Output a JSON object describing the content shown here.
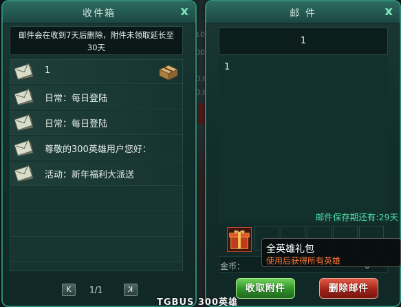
{
  "inbox": {
    "title": "收件箱",
    "close_label": "x",
    "notice": "邮件会在收到7天后删除，附件未领取延长至30天",
    "notice_line1": "邮件会在收到7天后删除，附件未领取延长至",
    "notice_line2": "30天",
    "mails": [
      {
        "subject": "1",
        "icon": "envelope-icon",
        "has_attachment": true
      },
      {
        "subject": "日常：每日登陆",
        "icon": "envelope-icon",
        "has_attachment": false
      },
      {
        "subject": "日常：每日登陆",
        "icon": "envelope-icon",
        "has_attachment": false
      },
      {
        "subject": "尊敬的300英雄用户您好：",
        "icon": "envelope-icon",
        "has_attachment": false
      },
      {
        "subject": "活动：新年福利大派送",
        "icon": "envelope-icon",
        "has_attachment": false
      }
    ],
    "pager": {
      "prev_label": "K",
      "page_text": "1/1",
      "next_label": "K"
    }
  },
  "mail": {
    "title": "邮 件",
    "close_label": "x",
    "subject": "1",
    "body": "1",
    "expiry_text": "邮件保存期还有:29天",
    "gold_label": "金币：",
    "gold_value": "0",
    "attachment_icon": "gift-box-icon"
  },
  "tooltip": {
    "title": "全英雄礼包",
    "description": "使用后获得所有英雄"
  },
  "actions": {
    "collect_label": "收取附件",
    "delete_label": "删除邮件"
  },
  "watermark": "TGBUS 300英雄",
  "background_numbers": [
    "10",
    "00",
    "0.6",
    "0.6"
  ],
  "colors": {
    "panel_border": "#2f8a78",
    "close_icon": "#7fe6b8",
    "expiry_text": "#4fe0a8",
    "tooltip_desc": "#ff7a3c",
    "collect_button": "#2f8f2a",
    "delete_button": "#a22418"
  }
}
